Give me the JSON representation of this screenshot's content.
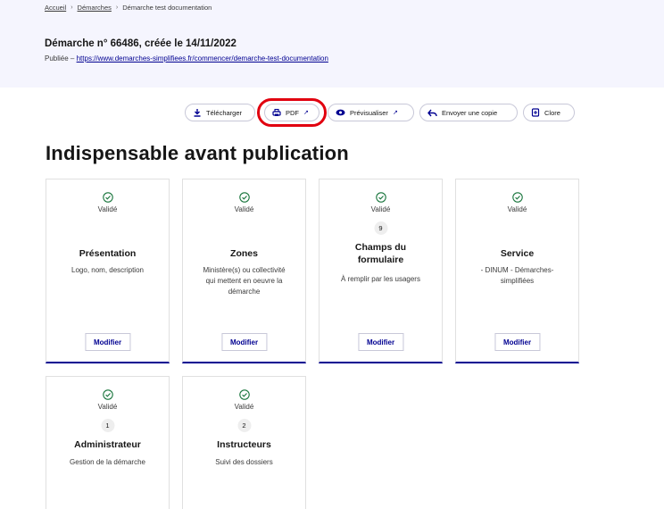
{
  "breadcrumb": [
    "Accueil",
    "Démarches",
    "Démarche test documentation"
  ],
  "header": {
    "title": "Démarche n° 66486, créée le 14/11/2022",
    "status_prefix": "Publiée – ",
    "url": "https://www.demarches-simplifiees.fr/commencer/demarche-test-documentation"
  },
  "toolbar": {
    "download": "Télécharger",
    "pdf": "PDF",
    "preview": "Prévisualiser",
    "send_copy": "Envoyer une copie",
    "close": "Clore"
  },
  "section_title": "Indispensable avant publication",
  "cards": [
    {
      "status": "Validé",
      "title": "Présentation",
      "description": "Logo, nom, description",
      "button": "Modifier"
    },
    {
      "status": "Validé",
      "title": "Zones",
      "description": "Ministère(s) ou collectivité qui mettent en oeuvre la démarche",
      "button": "Modifier"
    },
    {
      "status": "Validé",
      "count": "9",
      "title": "Champs du formulaire",
      "description": "À remplir par les usagers",
      "button": "Modifier"
    },
    {
      "status": "Validé",
      "title": "Service",
      "description": "- DINUM - Démarches-simplifiées",
      "button": "Modifier"
    },
    {
      "status": "Validé",
      "count": "1",
      "title": "Administrateur",
      "description": "Gestion de la démarche"
    },
    {
      "status": "Validé",
      "count": "2",
      "title": "Instructeurs",
      "description": "Suivi des dossiers"
    }
  ],
  "colors": {
    "accent": "#000091",
    "success": "#18753c",
    "highlight": "#e1000f",
    "header_bg": "#f5f5fe"
  }
}
